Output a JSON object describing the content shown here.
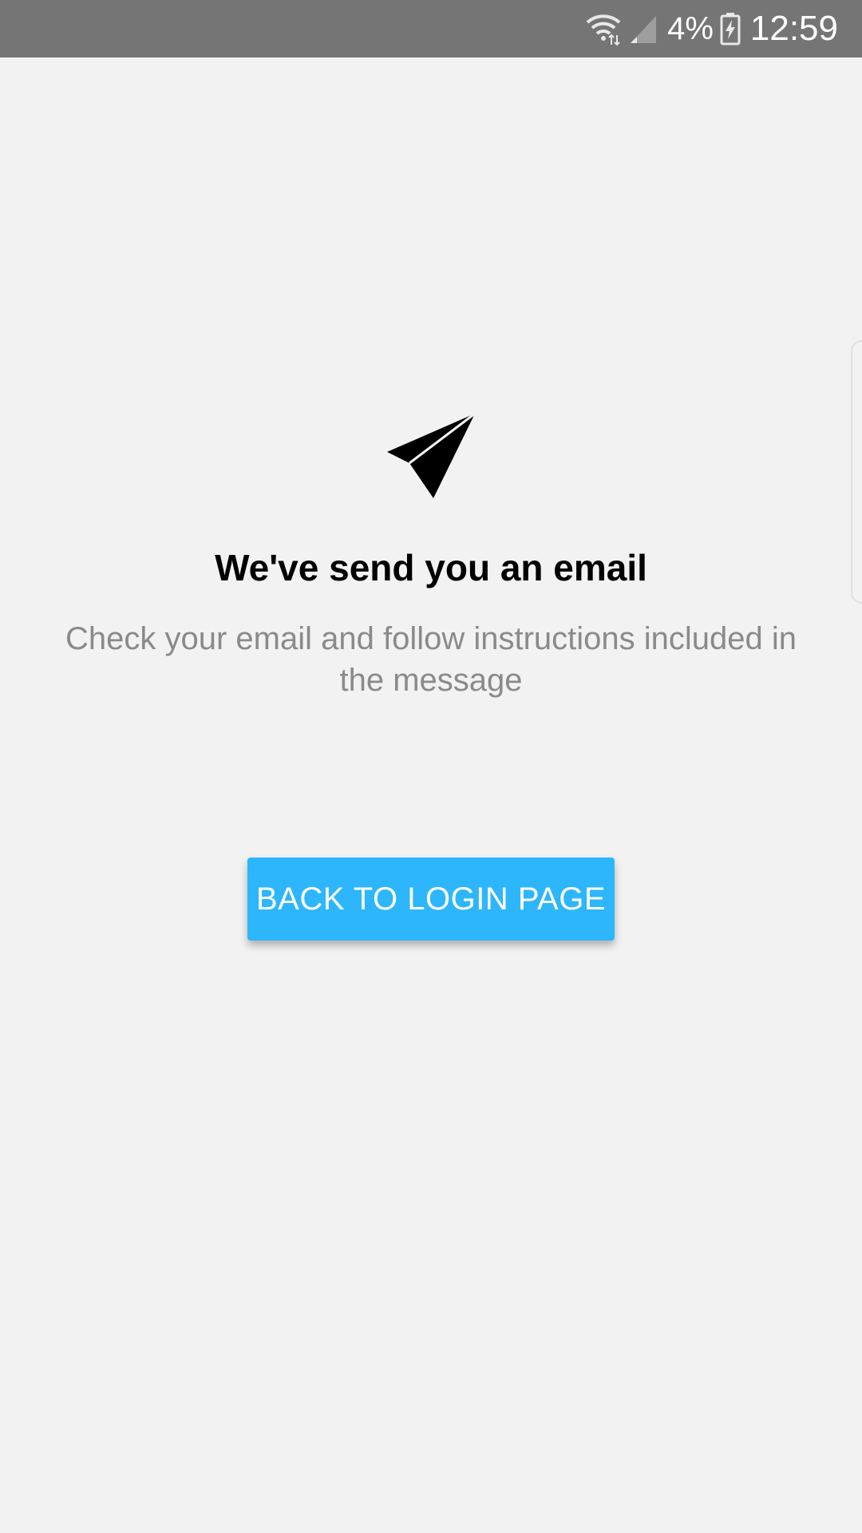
{
  "status_bar": {
    "battery_percent": "4%",
    "time": "12:59",
    "icons": [
      "wifi-icon",
      "signal-icon",
      "battery-charging-icon"
    ]
  },
  "main": {
    "icon": "paper-plane-icon",
    "title": "We've send you an email",
    "subtitle": "Check your email and follow instructions included in the message",
    "button_label": "BACK TO LOGIN PAGE"
  },
  "colors": {
    "status_bar_bg": "#757575",
    "page_bg": "#f2f2f2",
    "accent": "#2db6fb",
    "subtitle_text": "#8a8a8a"
  }
}
